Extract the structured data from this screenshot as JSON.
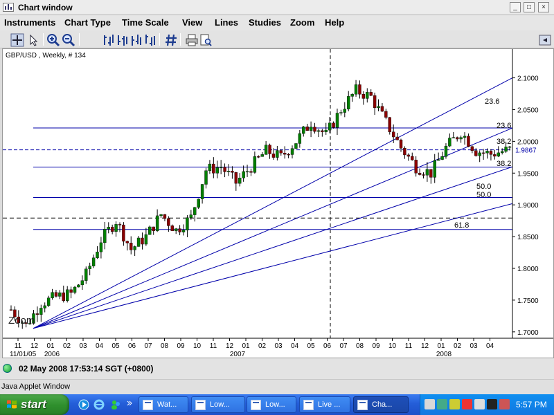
{
  "window": {
    "title": "Chart window"
  },
  "menu": [
    "Instruments",
    "Chart Type",
    "Time Scale",
    "View",
    "Lines",
    "Studies",
    "Zoom",
    "Help"
  ],
  "chart": {
    "header": "GBP/USD , Weekly, # 134",
    "zoom_label": "Zoom",
    "current_price_label": "1.9867",
    "y_ticks": [
      "2.1000",
      "2.0500",
      "2.0000",
      "1.9500",
      "1.9000",
      "1.8500",
      "1.8000",
      "1.7500",
      "1.7000"
    ],
    "x_months": [
      "11",
      "12",
      "01",
      "02",
      "03",
      "04",
      "05",
      "06",
      "07",
      "08",
      "09",
      "10",
      "11",
      "12",
      "01",
      "02",
      "03",
      "04",
      "05",
      "06",
      "07",
      "08",
      "09",
      "10",
      "11",
      "12",
      "01",
      "02",
      "03",
      "04"
    ],
    "x_years": [
      "11/01/05",
      "2006",
      "2007",
      "2008"
    ],
    "fib_labels": [
      "23.6",
      "23.6",
      "38.2",
      "38.2",
      "50.0",
      "50.0",
      "61.8"
    ],
    "colors": {
      "up": "#008000",
      "down": "#8b0000",
      "lines": "#0000aa",
      "background": "#ffffff"
    }
  },
  "chart_data": {
    "type": "candlestick",
    "title": "GBP/USD , Weekly, # 134",
    "x_range": [
      "2005-11",
      "2008-05"
    ],
    "ylim": [
      1.69,
      2.13
    ],
    "current_price": 1.9867,
    "fib_levels": [
      2.0211,
      1.9867,
      1.9594,
      1.9117,
      1.8612
    ],
    "dashed_level": 1.8793,
    "approx_path": [
      [
        0,
        1.735
      ],
      [
        4,
        1.71
      ],
      [
        8,
        1.745
      ],
      [
        12,
        1.755
      ],
      [
        16,
        1.76
      ],
      [
        20,
        1.79
      ],
      [
        24,
        1.845
      ],
      [
        28,
        1.875
      ],
      [
        32,
        1.83
      ],
      [
        36,
        1.85
      ],
      [
        40,
        1.885
      ],
      [
        44,
        1.86
      ],
      [
        48,
        1.88
      ],
      [
        52,
        1.955
      ],
      [
        56,
        1.96
      ],
      [
        60,
        1.935
      ],
      [
        64,
        1.96
      ],
      [
        68,
        1.985
      ],
      [
        72,
        1.975
      ],
      [
        76,
        2.0
      ],
      [
        80,
        2.03
      ],
      [
        84,
        2.01
      ],
      [
        88,
        2.05
      ],
      [
        92,
        2.08
      ],
      [
        96,
        2.07
      ],
      [
        100,
        2.03
      ],
      [
        104,
        1.99
      ],
      [
        108,
        1.96
      ],
      [
        112,
        1.95
      ],
      [
        116,
        1.99
      ],
      [
        120,
        2.015
      ],
      [
        124,
        1.985
      ],
      [
        128,
        1.98
      ],
      [
        133,
        1.987
      ]
    ]
  },
  "status": {
    "datetime": "02 May 2008 17:53:14  SGT (+0800)"
  },
  "applet": {
    "label": "Java Applet Window"
  },
  "taskbar": {
    "start_label": "start",
    "tasks": [
      "Wat...",
      "Low...",
      "Low...",
      "Live ...",
      "Cha..."
    ],
    "clock": "5:57 PM"
  }
}
